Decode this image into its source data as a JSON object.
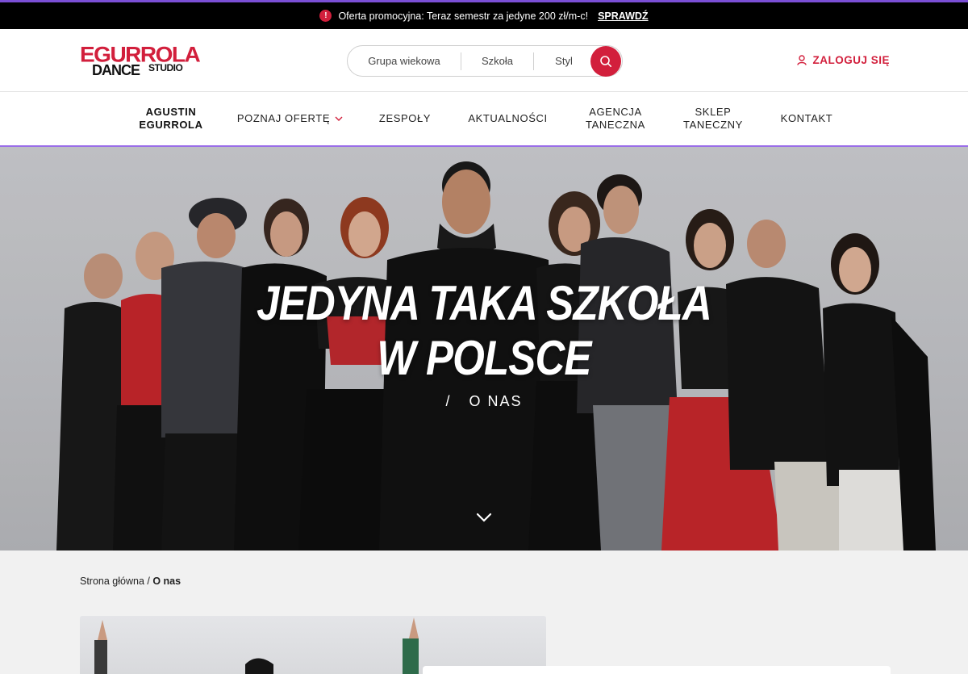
{
  "promo": {
    "icon": "alert-icon",
    "text": "Oferta promocyjna: Teraz semestr za jedyne 200 zł/m-c!",
    "link": "SPRAWDŹ"
  },
  "header": {
    "logo": {
      "line1": "EGURROLA",
      "line2": "DANCE",
      "line3": "STUDIO"
    },
    "search": {
      "segments": [
        "Grupa wiekowa",
        "Szkoła",
        "Styl"
      ],
      "icon": "search-icon"
    },
    "login": {
      "label": "ZALOGUJ SIĘ",
      "icon": "user-icon"
    }
  },
  "nav": {
    "items": [
      {
        "line1": "AGUSTIN",
        "line2": "EGURROLA"
      },
      {
        "label": "POZNAJ OFERTĘ",
        "icon": "chevron-down-icon"
      },
      {
        "label": "ZESPOŁY"
      },
      {
        "label": "AKTUALNOŚCI"
      },
      {
        "line1": "AGENCJA",
        "line2": "TANECZNA"
      },
      {
        "line1": "SKLEP",
        "line2": "TANECZNY"
      },
      {
        "label": "KONTAKT"
      }
    ]
  },
  "hero": {
    "title_line1": "JEDYNA TAKA SZKOŁA",
    "title_line2": "W POLSCE",
    "separator": "/",
    "subtitle": "O NAS",
    "scroll_icon": "chevron-down-icon"
  },
  "breadcrumb": {
    "home": "Strona główna",
    "separator": " / ",
    "current": "O nas"
  },
  "colors": {
    "brand_red": "#d21f3c",
    "accent_purple": "#9a6ee8",
    "promo_bg": "#000000"
  }
}
